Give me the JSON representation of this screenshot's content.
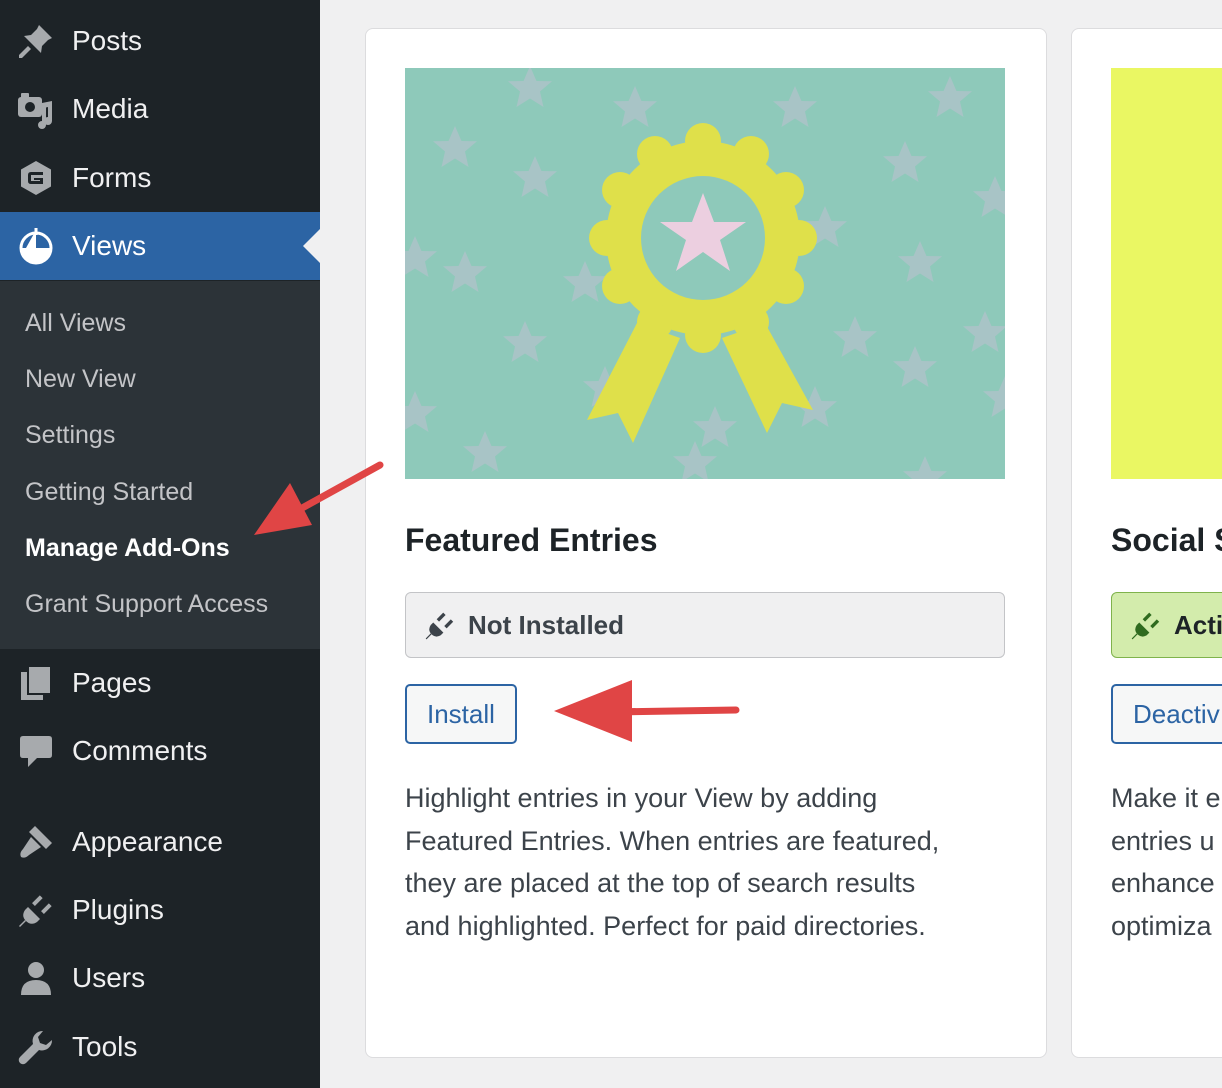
{
  "sidebar": {
    "items": [
      {
        "label": "Posts",
        "icon": "pushpin-icon"
      },
      {
        "label": "Media",
        "icon": "media-icon"
      },
      {
        "label": "Forms",
        "icon": "gravity-forms-icon"
      },
      {
        "label": "Views",
        "icon": "views-icon",
        "active": true
      },
      {
        "label": "Pages",
        "icon": "pages-icon"
      },
      {
        "label": "Comments",
        "icon": "comment-icon"
      },
      {
        "label": "Appearance",
        "icon": "paintbrush-icon"
      },
      {
        "label": "Plugins",
        "icon": "plugin-icon"
      },
      {
        "label": "Users",
        "icon": "user-icon"
      },
      {
        "label": "Tools",
        "icon": "wrench-icon"
      }
    ],
    "submenu": [
      "All Views",
      "New View",
      "Settings",
      "Getting Started",
      "Manage Add-Ons",
      "Grant Support Access"
    ],
    "current_submenu": "Manage Add-Ons"
  },
  "addons": [
    {
      "title": "Featured Entries",
      "status": "Not Installed",
      "button": "Install",
      "description": [
        "Highlight entries in your View by adding",
        "Featured Entries. When entries are featured,",
        "they are placed at the top of search results",
        "and highlighted. Perfect for paid directories."
      ]
    },
    {
      "title": "Social S",
      "status": "Acti",
      "button": "Deactiv",
      "description": [
        "Make it e",
        "entries u",
        "enhance",
        "optimiza"
      ]
    }
  ],
  "colors": {
    "sidebar_bg": "#1d2327",
    "active_menu": "#2c64a4",
    "annotation_arrow": "#e04545",
    "thumb_teal": "#8ec9ba",
    "thumb_yellow": "#dfe04a",
    "thumb2_lime": "#eaf763"
  }
}
